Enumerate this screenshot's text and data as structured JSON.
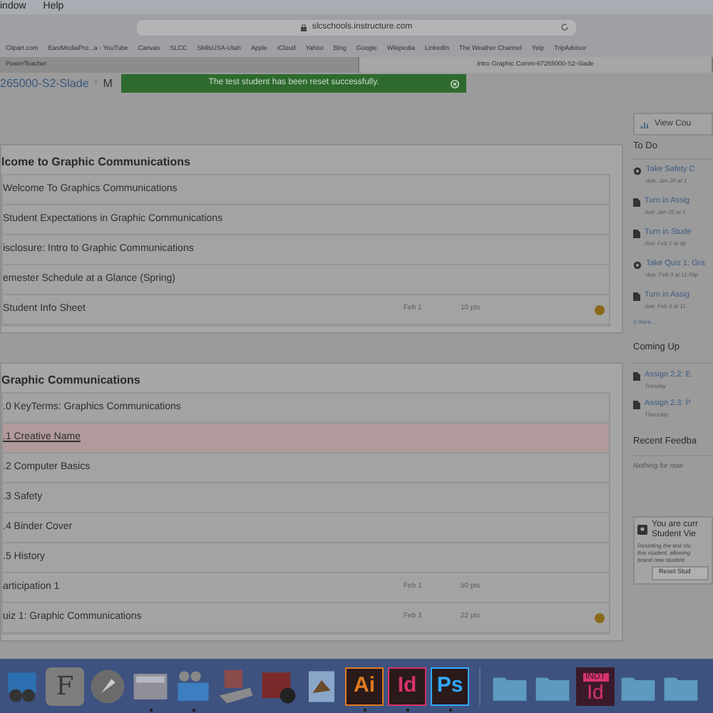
{
  "menu_bar": [
    "indow",
    "Help"
  ],
  "address_bar": {
    "url": "slcschools.instructure.com"
  },
  "bookmarks": [
    "Clipart.com",
    "EastMediaPro...a - YouTube",
    "Canvas",
    "SLCC",
    "SkillsUSA-Utah",
    "Apple",
    "iCloud",
    "Yahoo",
    "Bing",
    "Google",
    "Wikipedia",
    "LinkedIn",
    "The Weather Channel",
    "Yelp",
    "TripAdvisor"
  ],
  "tabs": [
    {
      "label": "PowerTeacher",
      "selected": false
    },
    {
      "label": "Intro Graphic Comm-67265000-S2-Slade",
      "selected": true
    }
  ],
  "breadcrumb": [
    "265000-S2-Slade",
    "›",
    "M"
  ],
  "notification": {
    "message": "The test student has been reset successfully."
  },
  "modules": [
    {
      "title": "lcome to Graphic Communications",
      "items": [
        {
          "title": "Welcome To Graphics Communications",
          "highlighted": false,
          "indicator": false
        },
        {
          "title": "Student Expectations in Graphic Communications",
          "highlighted": false,
          "indicator": false
        },
        {
          "title": "isclosure: Intro to Graphic Communications",
          "highlighted": false,
          "indicator": false
        },
        {
          "title": "emester Schedule at a Glance (Spring)",
          "highlighted": false,
          "indicator": false
        },
        {
          "title": "Student Info Sheet",
          "date": "Feb 1",
          "points": "10 pts",
          "highlighted": false,
          "indicator": true
        }
      ]
    },
    {
      "title": "Graphic Communications",
      "items": [
        {
          "title": ".0 KeyTerms: Graphics Communications",
          "highlighted": false,
          "indicator": false
        },
        {
          "title": ".1 Creative Name",
          "highlighted": true,
          "indicator": false
        },
        {
          "title": ".2 Computer Basics",
          "highlighted": false,
          "indicator": false
        },
        {
          "title": ".3 Safety",
          "highlighted": false,
          "indicator": false
        },
        {
          "title": ".4 Binder Cover",
          "highlighted": false,
          "indicator": false
        },
        {
          "title": ".5 History",
          "highlighted": false,
          "indicator": false
        },
        {
          "title": "articipation 1",
          "date": "Feb 1",
          "points": "50 pts",
          "highlighted": false,
          "indicator": false
        },
        {
          "title": "uiz 1: Graphic Communications",
          "date": "Feb 3",
          "points": "22 pts",
          "highlighted": false,
          "indicator": true
        }
      ]
    }
  ],
  "sidebar": {
    "view_button": "View Cou",
    "todo_heading": "To Do",
    "todo": [
      {
        "title": "Take Safety C",
        "due": "due: Jan 26 at 1",
        "kind": "quiz"
      },
      {
        "title": "Turn in Assig",
        "due": "due: Jan 26 at 1",
        "kind": "assignment"
      },
      {
        "title": "Turn in Stude",
        "due": "due: Feb 1 at 4p",
        "kind": "assignment"
      },
      {
        "title": "Take Quiz 1: Gra",
        "due": "due: Feb 3 at 11:59p",
        "kind": "quiz"
      },
      {
        "title": "Turn in Assig",
        "due": "due: Feb 3 at 11",
        "kind": "assignment"
      }
    ],
    "more": "2 more...",
    "coming_heading": "Coming Up",
    "coming": [
      {
        "title": "Assign 2.2: E",
        "when": "Tuesday"
      },
      {
        "title": "Assign 2.3: P",
        "when": "Thursday"
      }
    ],
    "feedback_heading": "Recent Feedba",
    "feedback_empty": "Nothing for now",
    "student_view": {
      "title": [
        "You are curr",
        "Student Vie"
      ],
      "text": [
        "Resetting the test stu",
        "this student, allowing",
        "brand new student."
      ],
      "button": "Reset Stud"
    }
  },
  "dock": [
    {
      "kind": "preview",
      "running": false
    },
    {
      "kind": "fontbook",
      "label": "F",
      "running": false
    },
    {
      "kind": "rocket",
      "running": false
    },
    {
      "kind": "screen",
      "running": true
    },
    {
      "kind": "video",
      "running": true
    },
    {
      "kind": "scanner",
      "running": false
    },
    {
      "kind": "photos",
      "running": false
    },
    {
      "kind": "mail",
      "running": false
    },
    {
      "kind": "adobe",
      "label": "Ai",
      "color": "#e07b20",
      "running": true
    },
    {
      "kind": "adobe",
      "label": "Id",
      "color": "#d6336c",
      "running": true
    },
    {
      "kind": "adobe",
      "label": "Ps",
      "color": "#31a8ff",
      "running": true
    },
    {
      "kind": "separator"
    },
    {
      "kind": "folder",
      "running": false
    },
    {
      "kind": "folder",
      "running": false
    },
    {
      "kind": "indt",
      "label": "Id",
      "tag": "INDT",
      "running": false
    },
    {
      "kind": "folder",
      "running": false
    },
    {
      "kind": "folder",
      "running": false
    }
  ]
}
